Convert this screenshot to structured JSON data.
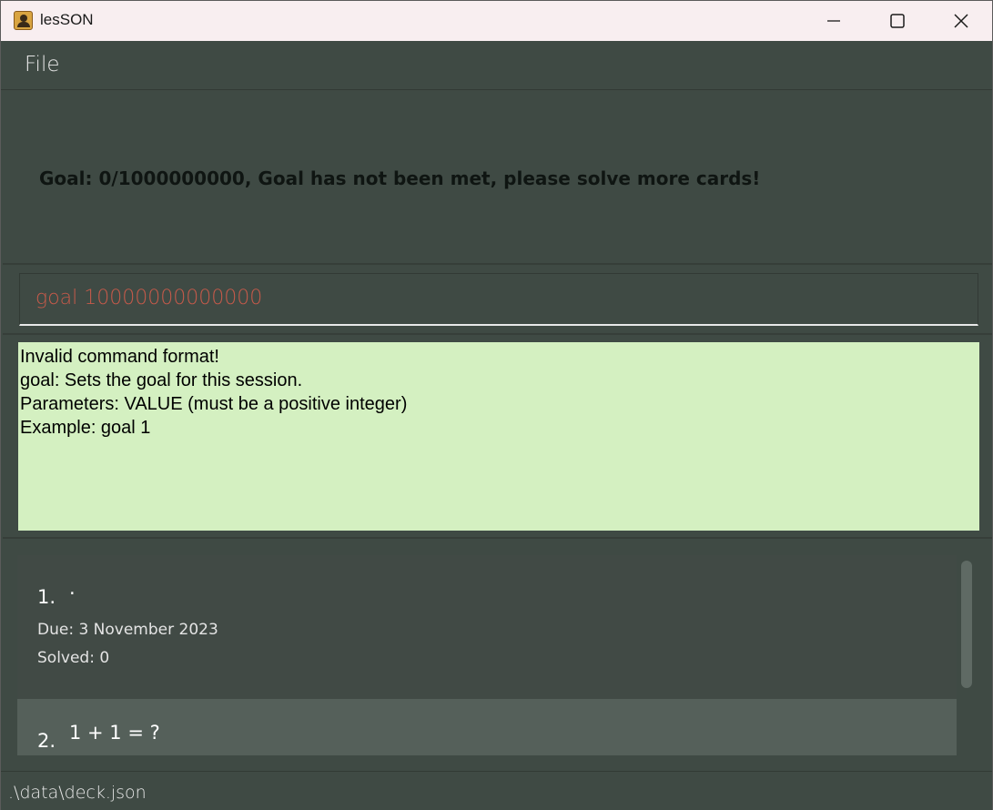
{
  "window": {
    "title": "lesSON"
  },
  "menu": {
    "file_label": "File"
  },
  "goal": {
    "message": "Goal: 0/1000000000, Goal has not been met, please solve more cards!"
  },
  "command": {
    "value": "goal 10000000000000"
  },
  "result": {
    "lines": [
      "Invalid command format!",
      "goal: Sets the goal for this session.",
      "Parameters: VALUE (must be a positive integer)",
      "Example: goal 1"
    ]
  },
  "cards": [
    {
      "index": "1.",
      "question": "·",
      "due": "Due: 3 November 2023",
      "solved": "Solved: 0"
    },
    {
      "index": "2.",
      "question": "1 + 1 = ?"
    }
  ],
  "status": {
    "file_path": ".\\data\\deck.json"
  },
  "colors": {
    "background": "#3f4a44",
    "result_bg": "#d4f0c1",
    "command_text": "#c65a4a",
    "title_bar": "#f8eef0"
  }
}
